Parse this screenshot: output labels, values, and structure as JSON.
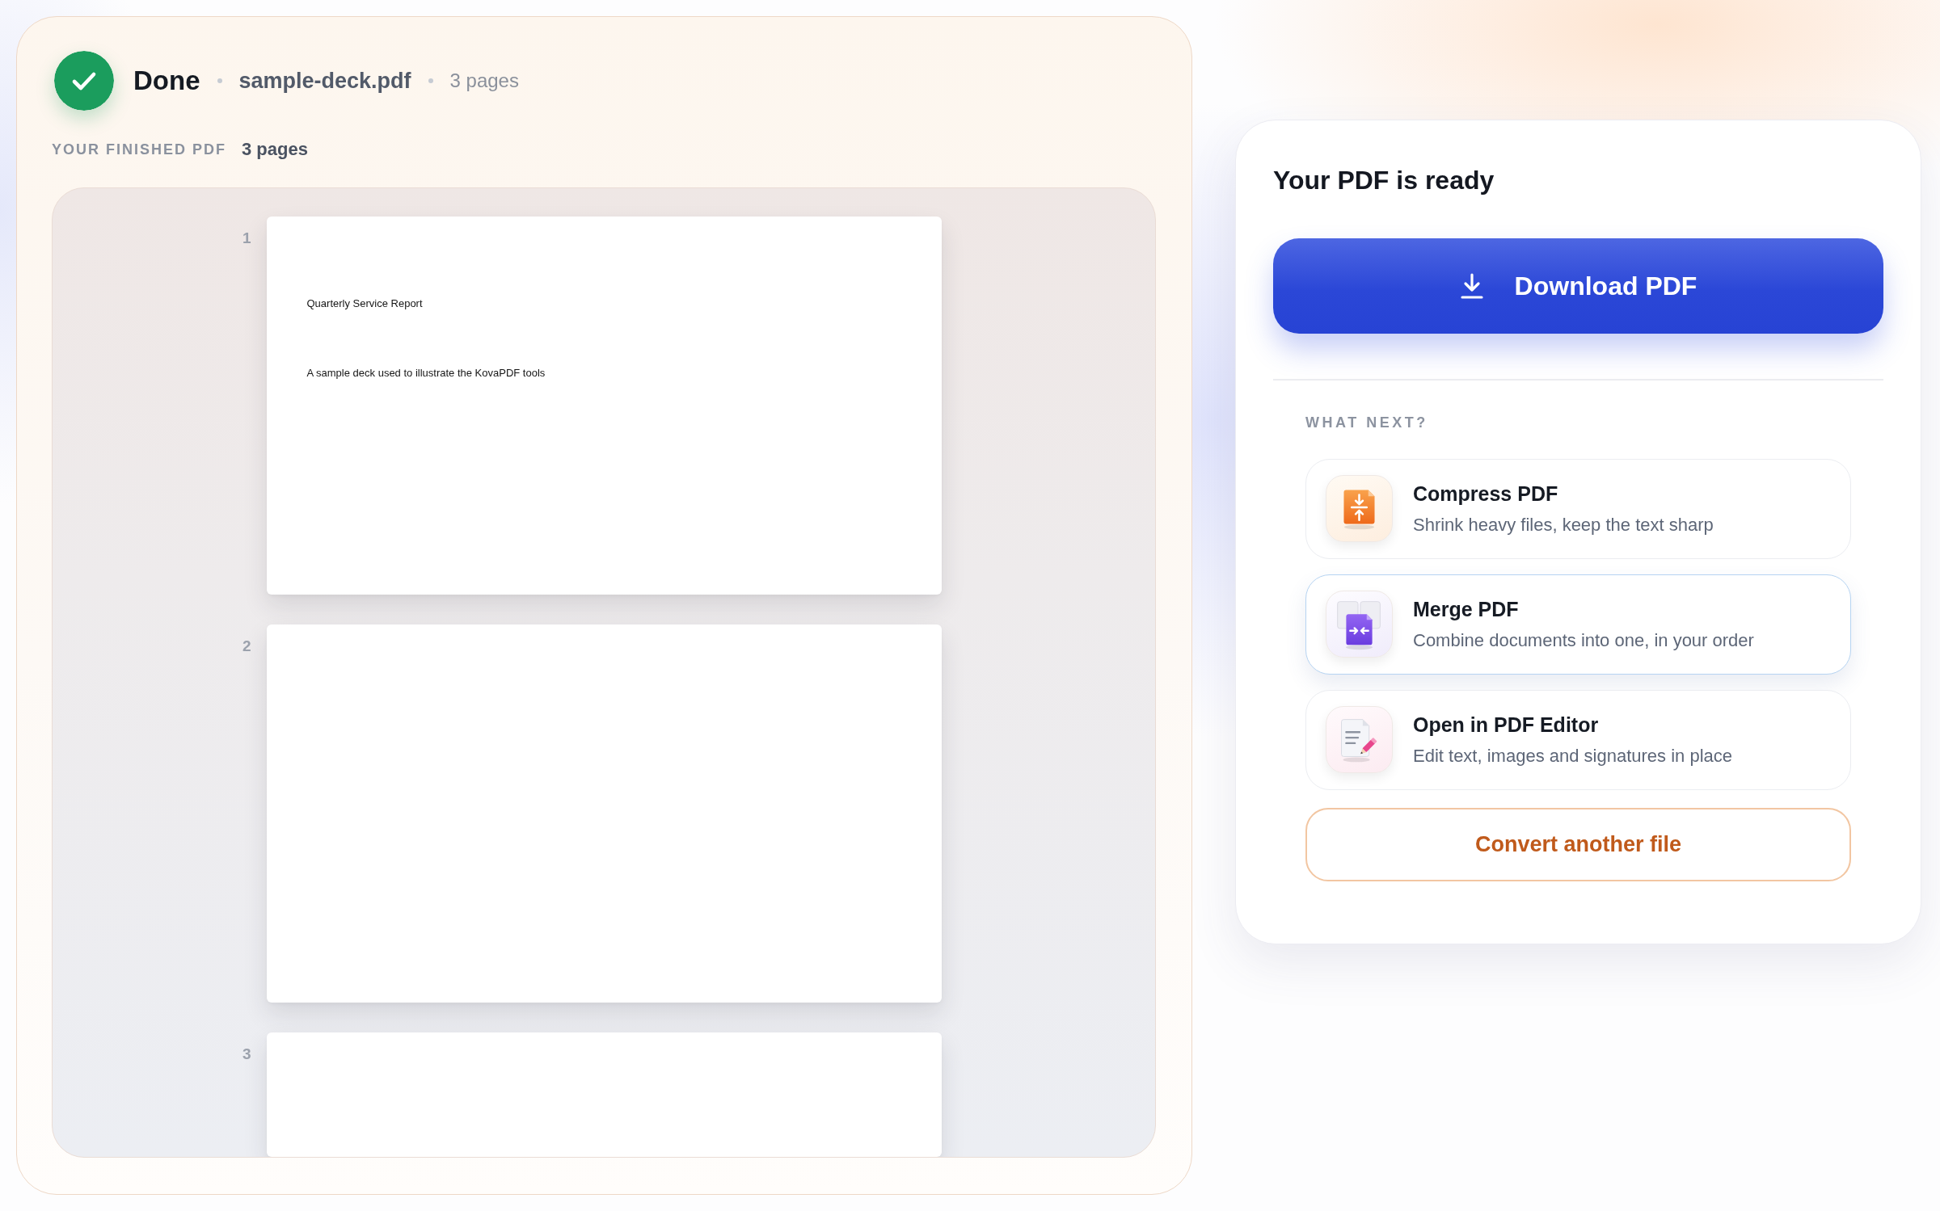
{
  "status": {
    "label": "Done",
    "file_name": "sample-deck.pdf",
    "page_count": "3 pages"
  },
  "preview": {
    "label": "YOUR FINISHED PDF",
    "page_count": "3 pages",
    "pages": [
      {
        "number": "1",
        "lines": [
          "Quarterly Service Report",
          "A sample deck used to illustrate the KovaPDF tools"
        ]
      },
      {
        "number": "2"
      },
      {
        "number": "3"
      }
    ]
  },
  "ready_card": {
    "title": "Your PDF is ready",
    "download_button": "Download PDF",
    "next_heading": "WHAT NEXT?",
    "actions": [
      {
        "kind": "compress",
        "title": "Compress PDF",
        "description": "Shrink heavy files, keep the text sharp",
        "selected": false
      },
      {
        "kind": "merge",
        "title": "Merge PDF",
        "description": "Combine documents into one, in your order",
        "selected": true
      },
      {
        "kind": "edit",
        "title": "Open in PDF Editor",
        "description": "Edit text, images and signatures in place",
        "selected": false
      }
    ],
    "convert_button": "Convert another file"
  }
}
